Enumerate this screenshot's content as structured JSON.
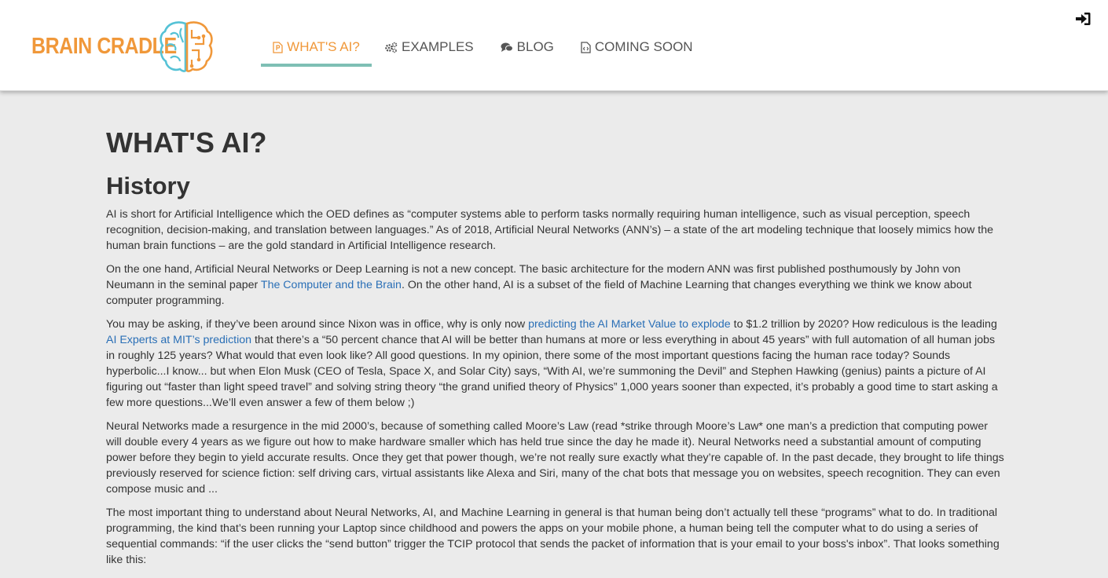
{
  "brand": {
    "name": "BRAIN CRADLE",
    "logo_icon": "brain-icon"
  },
  "nav": {
    "items": [
      {
        "label": "WHAT'S AI?",
        "icon": "document-icon",
        "active": true
      },
      {
        "label": "EXAMPLES",
        "icon": "gears-icon",
        "active": false
      },
      {
        "label": "BLOG",
        "icon": "comments-icon",
        "active": false
      },
      {
        "label": "COMING SOON",
        "icon": "code-file-icon",
        "active": false
      }
    ],
    "login_icon": "sign-in-icon"
  },
  "colors": {
    "brand_orange": "#f0983a",
    "active_underline": "#7ebfb4",
    "logo_teal": "#55c2d6",
    "link_blue": "#2a6fb6",
    "page_bg": "#ebebeb"
  },
  "page": {
    "title": "WHAT'S AI?",
    "section": "History",
    "p1": "AI is short for Artificial Intelligence which the OED defines as “computer systems able to perform tasks normally requiring human intelligence, such as visual perception, speech recognition, decision-making, and translation between languages.” As of 2018, Artificial Neural Networks (ANN’s) – a state of the art modeling technique that loosely mimics how the human brain functions – are the gold standard in Artificial Intelligence research.",
    "p2": {
      "a": "On the one hand, Artificial Neural Networks or Deep Learning is not a new concept. The basic architecture for the modern ANN was first published posthumously by John von Neumann in the seminal paper ",
      "link": "The Computer and the Brain",
      "b": ". On the other hand, AI is a subset of the field of Machine Learning that changes everything we think we know about computer programming."
    },
    "p3": {
      "a": "You may be asking, if they’ve been around since Nixon was in office, why is only now ",
      "link1": "predicting the AI Market Value to explode",
      "b": " to $1.2 trillion by 2020? How rediculous is the leading ",
      "link2": "AI Experts at MIT’s prediction",
      "c": " that there’s a “50 percent chance that AI will be better than humans at more or less everything in about 45 years” with full automation of all human jobs in roughly 125 years? What would that even look like? All good questions. In my opinion, there some of the most important questions facing the human race today? Sounds hyperbolic...I know... but when Elon Musk (CEO of Tesla, Space X, and Solar City) says, “With AI, we’re summoning the Devil” and Stephen Hawking (genius) paints a picture of AI figuring out “faster than light speed travel” and solving string theory “the grand unified theory of Physics” 1,000 years sooner than expected, it’s probably a good time to start asking a few more questions...We’ll even answer a few of them below ;)"
    },
    "p4": "Neural Networks made a resurgence in the mid 2000’s, because of something called Moore’s Law (read *strike through Moore’s Law* one man’s a prediction that computing power will double every 4 years as we figure out how to make hardware smaller which has held true since the day he made it). Neural Networks need a substantial amount of computing power before they begin to yield accurate results. Once they get that power though, we’re not really sure exactly what they’re capable of. In the past decade, they brought to life things previously reserved for science fiction: self driving cars, virtual assistants like Alexa and Siri, many of the chat bots that message you on websites, speech recognition. They can even compose music and ...",
    "p5": "The most important thing to understand about Neural Networks, AI, and Machine Learning in general is that human being don’t actually tell these “programs” what to do. In traditional programming, the kind that’s been running your Laptop since childhood and powers the apps on your mobile phone, a human being tell the computer what to do using a series of sequential commands: “if the user clicks the “send button” trigger the TCIP protocol that sends the packet of information that is your email to your boss's inbox”. That looks something like this:"
  }
}
